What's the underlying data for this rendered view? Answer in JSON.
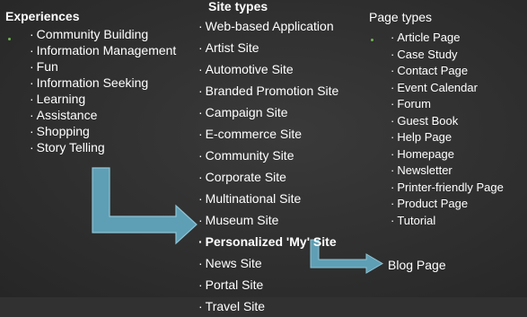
{
  "experiences": {
    "heading": "Experiences",
    "items": [
      "Community Building",
      "Information Management",
      "Fun",
      "Information Seeking",
      "Learning",
      "Assistance",
      "Shopping",
      "Story Telling"
    ]
  },
  "site_types": {
    "heading": "Site types",
    "items": [
      "Web-based Application",
      "Artist Site",
      "Automotive Site",
      "Branded Promotion Site",
      "Campaign Site",
      "E-commerce Site",
      "Community Site",
      "Corporate Site",
      "Multinational Site",
      "Museum Site",
      "Personalized 'My' Site",
      "News Site",
      "Portal Site",
      "Travel Site"
    ],
    "highlighted": "Personalized 'My' Site"
  },
  "page_types": {
    "heading": "Page types",
    "items": [
      "Article Page",
      "Case Study",
      "Contact Page",
      "Event Calendar",
      "Forum",
      "Guest Book",
      "Help Page",
      "Homepage",
      "Newsletter",
      "Printer-friendly Page",
      "Product Page",
      "Tutorial"
    ]
  },
  "blog_page": "Blog Page",
  "item_marker": "·",
  "colors": {
    "background": "#313131",
    "text": "#ffffff",
    "arrow_fill": "#5f9fb5",
    "arrow_stroke": "#8fc4d6",
    "bullet": "#6fb64f"
  }
}
